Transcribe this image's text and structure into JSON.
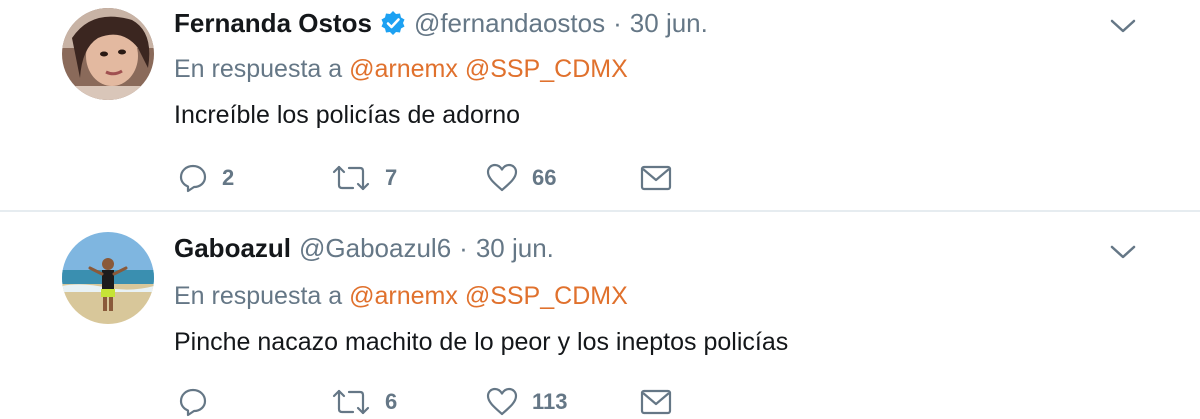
{
  "tweets": [
    {
      "name": "Fernanda Ostos",
      "verified": true,
      "handle": "@fernandaostos",
      "separator": "·",
      "date": "30 jun.",
      "reply_prefix": "En respuesta a",
      "mentions": [
        "@arnemx",
        "@SSP_CDMX"
      ],
      "text": "Increíble los policías de adorno",
      "replies": "2",
      "retweets": "7",
      "likes": "66"
    },
    {
      "name": "Gaboazul",
      "verified": false,
      "handle": "@Gaboazul6",
      "separator": "·",
      "date": "30 jun.",
      "reply_prefix": "En respuesta a",
      "mentions": [
        "@arnemx",
        "@SSP_CDMX"
      ],
      "text": "Pinche nacazo machito de lo peor y los ineptos policías",
      "replies": "",
      "retweets": "6",
      "likes": "113"
    }
  ],
  "colors": {
    "mention": "#e0712d",
    "muted": "#657786",
    "verified": "#1da1f2",
    "divider": "#e6ecf0"
  },
  "icons": {
    "reply": "reply-icon",
    "retweet": "retweet-icon",
    "like": "heart-icon",
    "dm": "envelope-icon",
    "menu": "chevron-down-icon",
    "verified": "verified-badge-icon"
  }
}
